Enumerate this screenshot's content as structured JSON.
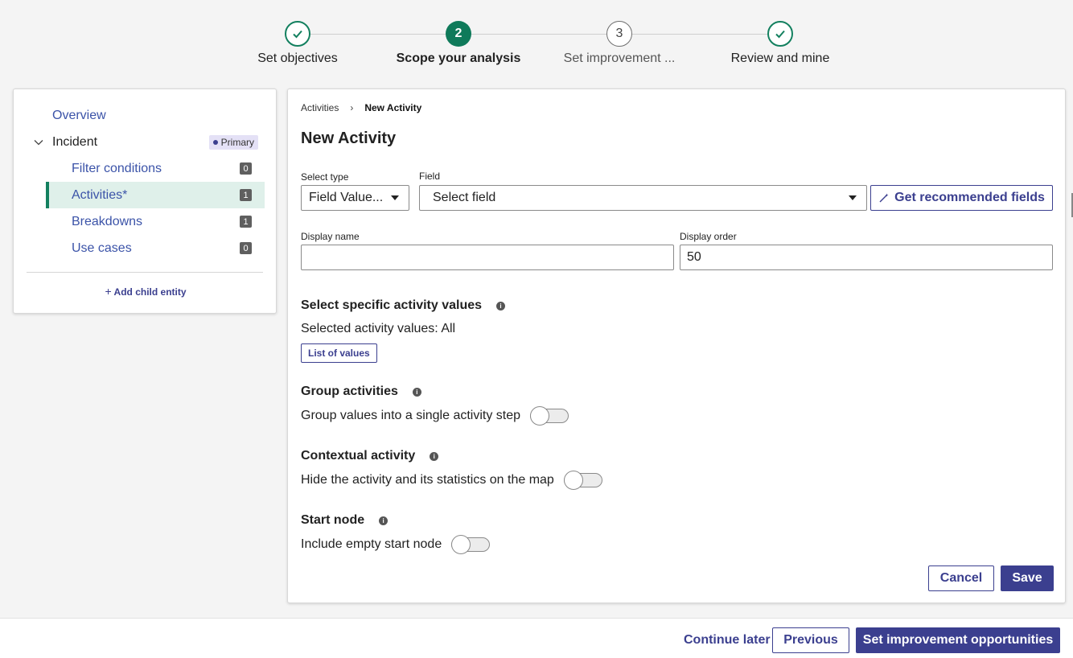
{
  "stepper": {
    "steps": [
      {
        "number": "",
        "label": "Set objectives",
        "state": "done"
      },
      {
        "number": "2",
        "label": "Scope your analysis",
        "state": "active"
      },
      {
        "number": "3",
        "label": "Set improvement ...",
        "state": "pending"
      },
      {
        "number": "",
        "label": "Review and mine",
        "state": "done"
      }
    ]
  },
  "sidebar": {
    "overview": "Overview",
    "incident": {
      "label": "Incident",
      "badge": "Primary"
    },
    "items": [
      {
        "label": "Filter conditions",
        "count": "0"
      },
      {
        "label": "Activities*",
        "count": "1",
        "selected": true
      },
      {
        "label": "Breakdowns",
        "count": "1"
      },
      {
        "label": "Use cases",
        "count": "0"
      }
    ],
    "add_child": "Add child entity"
  },
  "main": {
    "breadcrumb": {
      "parent": "Activities",
      "current": "New Activity"
    },
    "title": "New Activity",
    "select_type": {
      "label": "Select type",
      "value": "Field Value..."
    },
    "field": {
      "label": "Field",
      "value": "Select field"
    },
    "recommend_button": "Get recommended fields",
    "display_name": {
      "label": "Display name",
      "value": ""
    },
    "display_order": {
      "label": "Display order",
      "value": "50"
    },
    "specific_values": {
      "heading": "Select specific activity values",
      "selected_text": "Selected activity values: All",
      "list_button": "List of values"
    },
    "group_activities": {
      "heading": "Group activities",
      "text": "Group values into a single activity step",
      "on": false
    },
    "contextual_activity": {
      "heading": "Contextual activity",
      "text": "Hide the activity and its statistics on the map",
      "on": false
    },
    "start_node": {
      "heading": "Start node",
      "text": "Include empty start node",
      "on": false
    },
    "cancel": "Cancel",
    "save": "Save"
  },
  "footer": {
    "continue_later": "Continue later",
    "previous": "Previous",
    "next": "Set improvement opportunities"
  },
  "colors": {
    "accent": "#3b3f8f",
    "success": "#13805f",
    "link": "#3b53a8"
  }
}
